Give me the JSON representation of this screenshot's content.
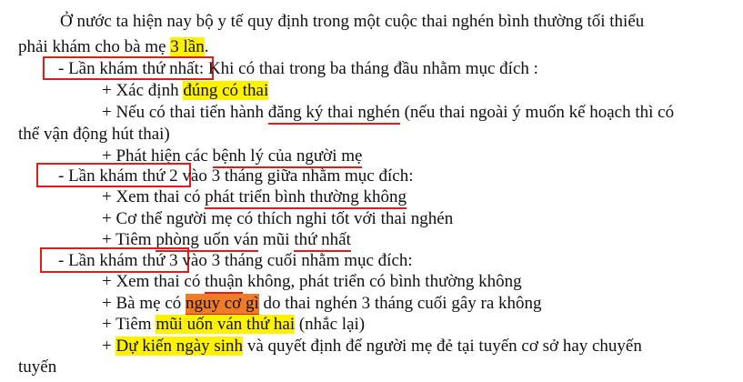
{
  "document": {
    "p1_l1": "Ở nước ta hiện nay bộ y tế quy định trong một cuộc thai nghén bình thường tối thiểu",
    "p1_l2a": "phải khám cho bà mẹ ",
    "p1_l2b": "3 lần",
    "p1_l2c": ".",
    "s1_title": "- Lần khám thứ nhất",
    "s1_rest": ": Khi có thai trong ba tháng đầu nhằm mục đích :",
    "s1_i1a": "+ Xác định ",
    "s1_i1b": "đúng có thai",
    "s1_i2a": "+ Nếu có thai tiến hành ",
    "s1_i2b": "đăng ký thai nghén",
    "s1_i2c": " (nếu thai ngoài ý muốn kế hoạch thì có",
    "s1_i2d": "thể vận động hút thai)",
    "s1_i3a": "+ Phát hiện các ",
    "s1_i3b": "bệnh lý của người mẹ",
    "s2_title": "- Lần khám thứ 2",
    "s2_rest": " vào 3 tháng giữa nhằm mục đích:",
    "s2_i1a": "+ Xem thai có ",
    "s2_i1b": "phát triển bình thường không",
    "s2_i2": "+ Cơ thể người mẹ có thích nghi tốt với thai nghén",
    "s2_i3a": "+ Tiêm ",
    "s2_i3b": "phòng uốn ván",
    "s2_i3c": " mũi ",
    "s2_i3d": "thứ nhất",
    "s3_title": "- Lần khám thứ 3",
    "s3_rest": " vào 3 tháng cuối nhằm mục đích:",
    "s3_i1a": "+ Xem thai có ",
    "s3_i1b": "thuận",
    "s3_i1c": " không, phát triển có bình thường không",
    "s3_i2a": "+ Bà mẹ có ",
    "s3_i2b": "nguy cơ gì",
    "s3_i2c": " do thai nghén 3 tháng cuối gây ra không",
    "s3_i3a": "+ Tiêm ",
    "s3_i3b": "mũi uốn ván thứ hai",
    "s3_i3c": " (nhắc lại)",
    "s3_i4a": "+ ",
    "s3_i4b": "Dự kiến ngày sinh",
    "s3_i4c": " và quyết định để người mẹ đẻ tại tuyến cơ sở hay chuyến",
    "s3_i4d": "tuyến"
  },
  "colors": {
    "highlight_yellow": "#fff200",
    "highlight_orange": "#f07c28",
    "annotation_red": "#e21c1c"
  }
}
